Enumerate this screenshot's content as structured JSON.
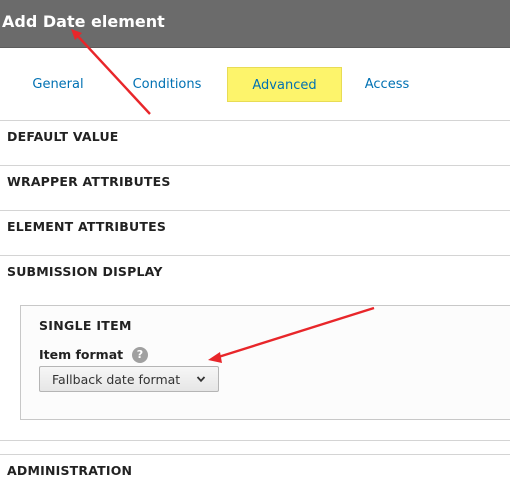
{
  "dialog": {
    "title": "Add Date element"
  },
  "tabs": [
    {
      "label": "General",
      "active": false
    },
    {
      "label": "Conditions",
      "active": false
    },
    {
      "label": "Advanced",
      "active": true
    },
    {
      "label": "Access",
      "active": false
    }
  ],
  "sections": {
    "default_value": "DEFAULT VALUE",
    "wrapper_attributes": "WRAPPER ATTRIBUTES",
    "element_attributes": "ELEMENT ATTRIBUTES",
    "submission_display": "SUBMISSION DISPLAY",
    "administration": "ADMINISTRATION"
  },
  "submission_display": {
    "single_item": {
      "legend": "SINGLE ITEM",
      "item_format_label": "Item format",
      "help_glyph": "?",
      "item_format_value": "Fallback date format"
    }
  },
  "colors": {
    "header_bg": "#6b6b6b",
    "tab_link": "#0071b3",
    "active_tab_highlight": "#fdf46b",
    "annotation_arrow": "#e8262a"
  },
  "icons": {
    "help": "question-circle-icon",
    "dropdown": "chevron-down-icon"
  }
}
